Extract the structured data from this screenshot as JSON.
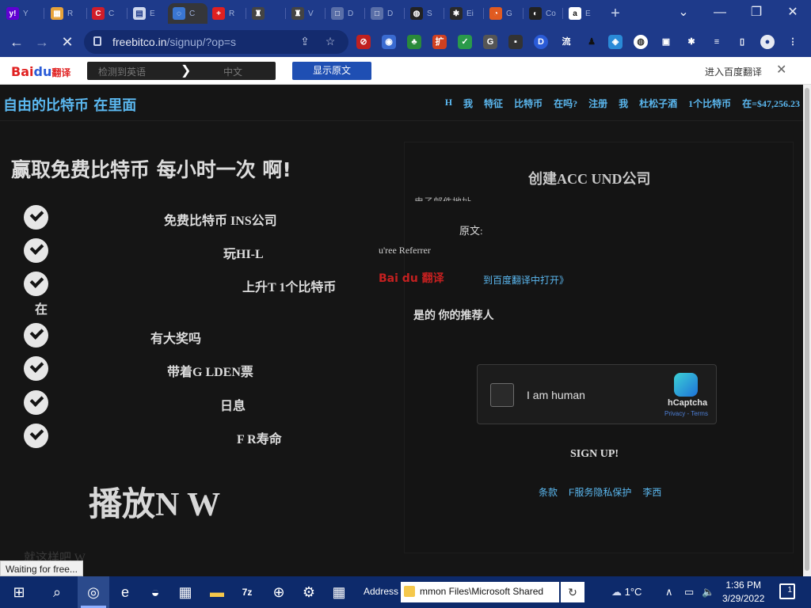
{
  "browser": {
    "tabs": [
      {
        "icon": "y!",
        "title": "Y",
        "color": "#6001d2"
      },
      {
        "icon": "▦",
        "title": "R",
        "color": "#e8a33a"
      },
      {
        "icon": "C",
        "title": "C",
        "color": "#d01d2a"
      },
      {
        "icon": "▤",
        "title": "E",
        "color": "#cfd8ee"
      },
      {
        "icon": "◌",
        "title": "C",
        "color": "#3a76d1",
        "active": true
      },
      {
        "icon": "+",
        "title": "R",
        "color": "#e02020"
      },
      {
        "icon": "♜",
        "title": "",
        "color": "#444"
      },
      {
        "icon": "♜",
        "title": "V",
        "color": "#444"
      },
      {
        "icon": "□",
        "title": "D",
        "color": "#5a6fa8"
      },
      {
        "icon": "□",
        "title": "D",
        "color": "#5a6fa8"
      },
      {
        "icon": "◍",
        "title": "S",
        "color": "#222"
      },
      {
        "icon": "✱",
        "title": "Ei",
        "color": "#2a2a2a"
      },
      {
        "icon": "◔",
        "title": "G",
        "color": "#e05a20"
      },
      {
        "icon": "◐",
        "title": "Co",
        "color": "#222"
      },
      {
        "icon": "a",
        "title": "E",
        "color": "#111"
      }
    ],
    "new_tab": "+",
    "window_controls": {
      "minimize": "⌄",
      "restore": "—",
      "maximize": "❐",
      "close": "✕"
    },
    "nav": {
      "back": "←",
      "forward": "→",
      "stop": "✕"
    },
    "url_host": "freebitco.in",
    "url_path": "/signup/?op=s",
    "omnibox_icons": {
      "share": "⇪",
      "bookmark": "☆"
    },
    "extensions": [
      "⊘",
      "◉",
      "♣",
      "扩",
      "✓",
      "G",
      "▪",
      "D",
      "流",
      "♟",
      "◈",
      "◍",
      "▣",
      "✱",
      "≡",
      "▯",
      "●",
      "⋮"
    ]
  },
  "baidu": {
    "logo_text": "Bai",
    "logo_paw": "du",
    "logo_suffix": "翻译",
    "source_lang": "检测到英语",
    "arrow": "❯",
    "target_lang": "中文",
    "show_original": "显示原文",
    "open_in_baidu": "进入百度翻译",
    "close": "✕"
  },
  "page": {
    "brand": "自由的比特币  在里面",
    "nav_links": [
      "H",
      "我",
      "特征",
      "比特币",
      "在吗?",
      "注册",
      "我",
      "杜松子酒",
      "1个比特币",
      "在=$47,256.23"
    ],
    "hero": "赢取免费比特币  每小时一次  啊!",
    "features": [
      "免费比特币 INS公司",
      "玩HI-L",
      "上升T  1个比特币",
      "有大奖吗",
      "带着G LDEN票",
      "日息",
      "F R寿命"
    ],
    "feature_continuation": "在",
    "play_now": "播放N  W",
    "faded_text": "就这样吧  W",
    "signup_card": {
      "title": "创建ACC  UND公司",
      "cut_label": "电子邮件地址",
      "tooltip_original": "原文:",
      "tooltip_ref": "u'ree Referrer",
      "tooltip_baidu": "Bai du 翻译",
      "tooltip_open": "到百度翻译中打开》",
      "referrer_label": "是的  你的推荐人",
      "captcha_label": "I am human",
      "captcha_brand": "hCaptcha",
      "captcha_links": "Privacy - Terms",
      "signup_button": "SIGN UP!",
      "footer_links": [
        "条款",
        "F服务隐私保护",
        "李西"
      ]
    }
  },
  "status_bar": "Waiting for free...",
  "taskbar": {
    "start": "⊞",
    "search": "⌕",
    "apps": [
      "◎",
      "e",
      "◒",
      "▦",
      "▬",
      "7z",
      "⊕",
      "⚙",
      "▦"
    ],
    "address_label": "Address",
    "address_value": "mmon Files\\Microsoft Shared",
    "address_go": "↻",
    "weather": "1°C",
    "tray_icons": [
      "∧",
      "▭",
      "🔈"
    ],
    "time": "1:36 PM",
    "date": "3/29/2022",
    "notifications": "1"
  }
}
